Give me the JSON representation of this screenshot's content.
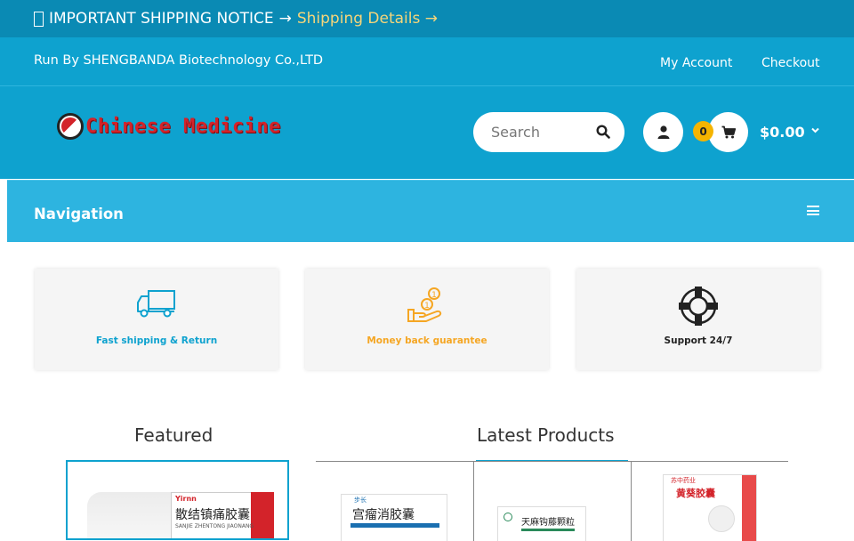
{
  "notice": {
    "text": "IMPORTANT SHIPPING NOTICE",
    "arrow": "→",
    "link": "Shipping Details →"
  },
  "topbar": {
    "company": "Run By SHENGBANDA Biotechnology Co.,LTD",
    "my_account": "My Account",
    "checkout": "Checkout"
  },
  "header": {
    "logo_text": "Chinese Medicine",
    "search_placeholder": "Search",
    "cart_count": "0",
    "cart_total": "$0.00"
  },
  "nav": {
    "title": "Navigation"
  },
  "features": [
    {
      "label": "Fast shipping & Return",
      "color": "#0ea2cf",
      "icon": "truck-icon"
    },
    {
      "label": "Money back guarantee",
      "color": "#f5a623",
      "icon": "money-hand-icon"
    },
    {
      "label": "Support 24/7",
      "color": "#222222",
      "icon": "lifebuoy-icon"
    }
  ],
  "sections": {
    "featured": "Featured",
    "latest": "Latest Products"
  },
  "products": {
    "featured_label": "散结镇痛胶囊",
    "featured_sub": "SANJIE ZHENTONG JIAONANG",
    "featured_brand": "Yirnn",
    "latest": [
      {
        "name": "宫瘤消胶囊",
        "brand": "步长"
      },
      {
        "name": "天麻钩藤颗粒",
        "brand": ""
      },
      {
        "name": "黄葵胶囊",
        "brand": "苏中药业"
      }
    ]
  },
  "colors": {
    "primary": "#0ea2cf",
    "notice": "#0a8ab4",
    "accent": "#f5d57a",
    "badge": "#f5b400"
  }
}
